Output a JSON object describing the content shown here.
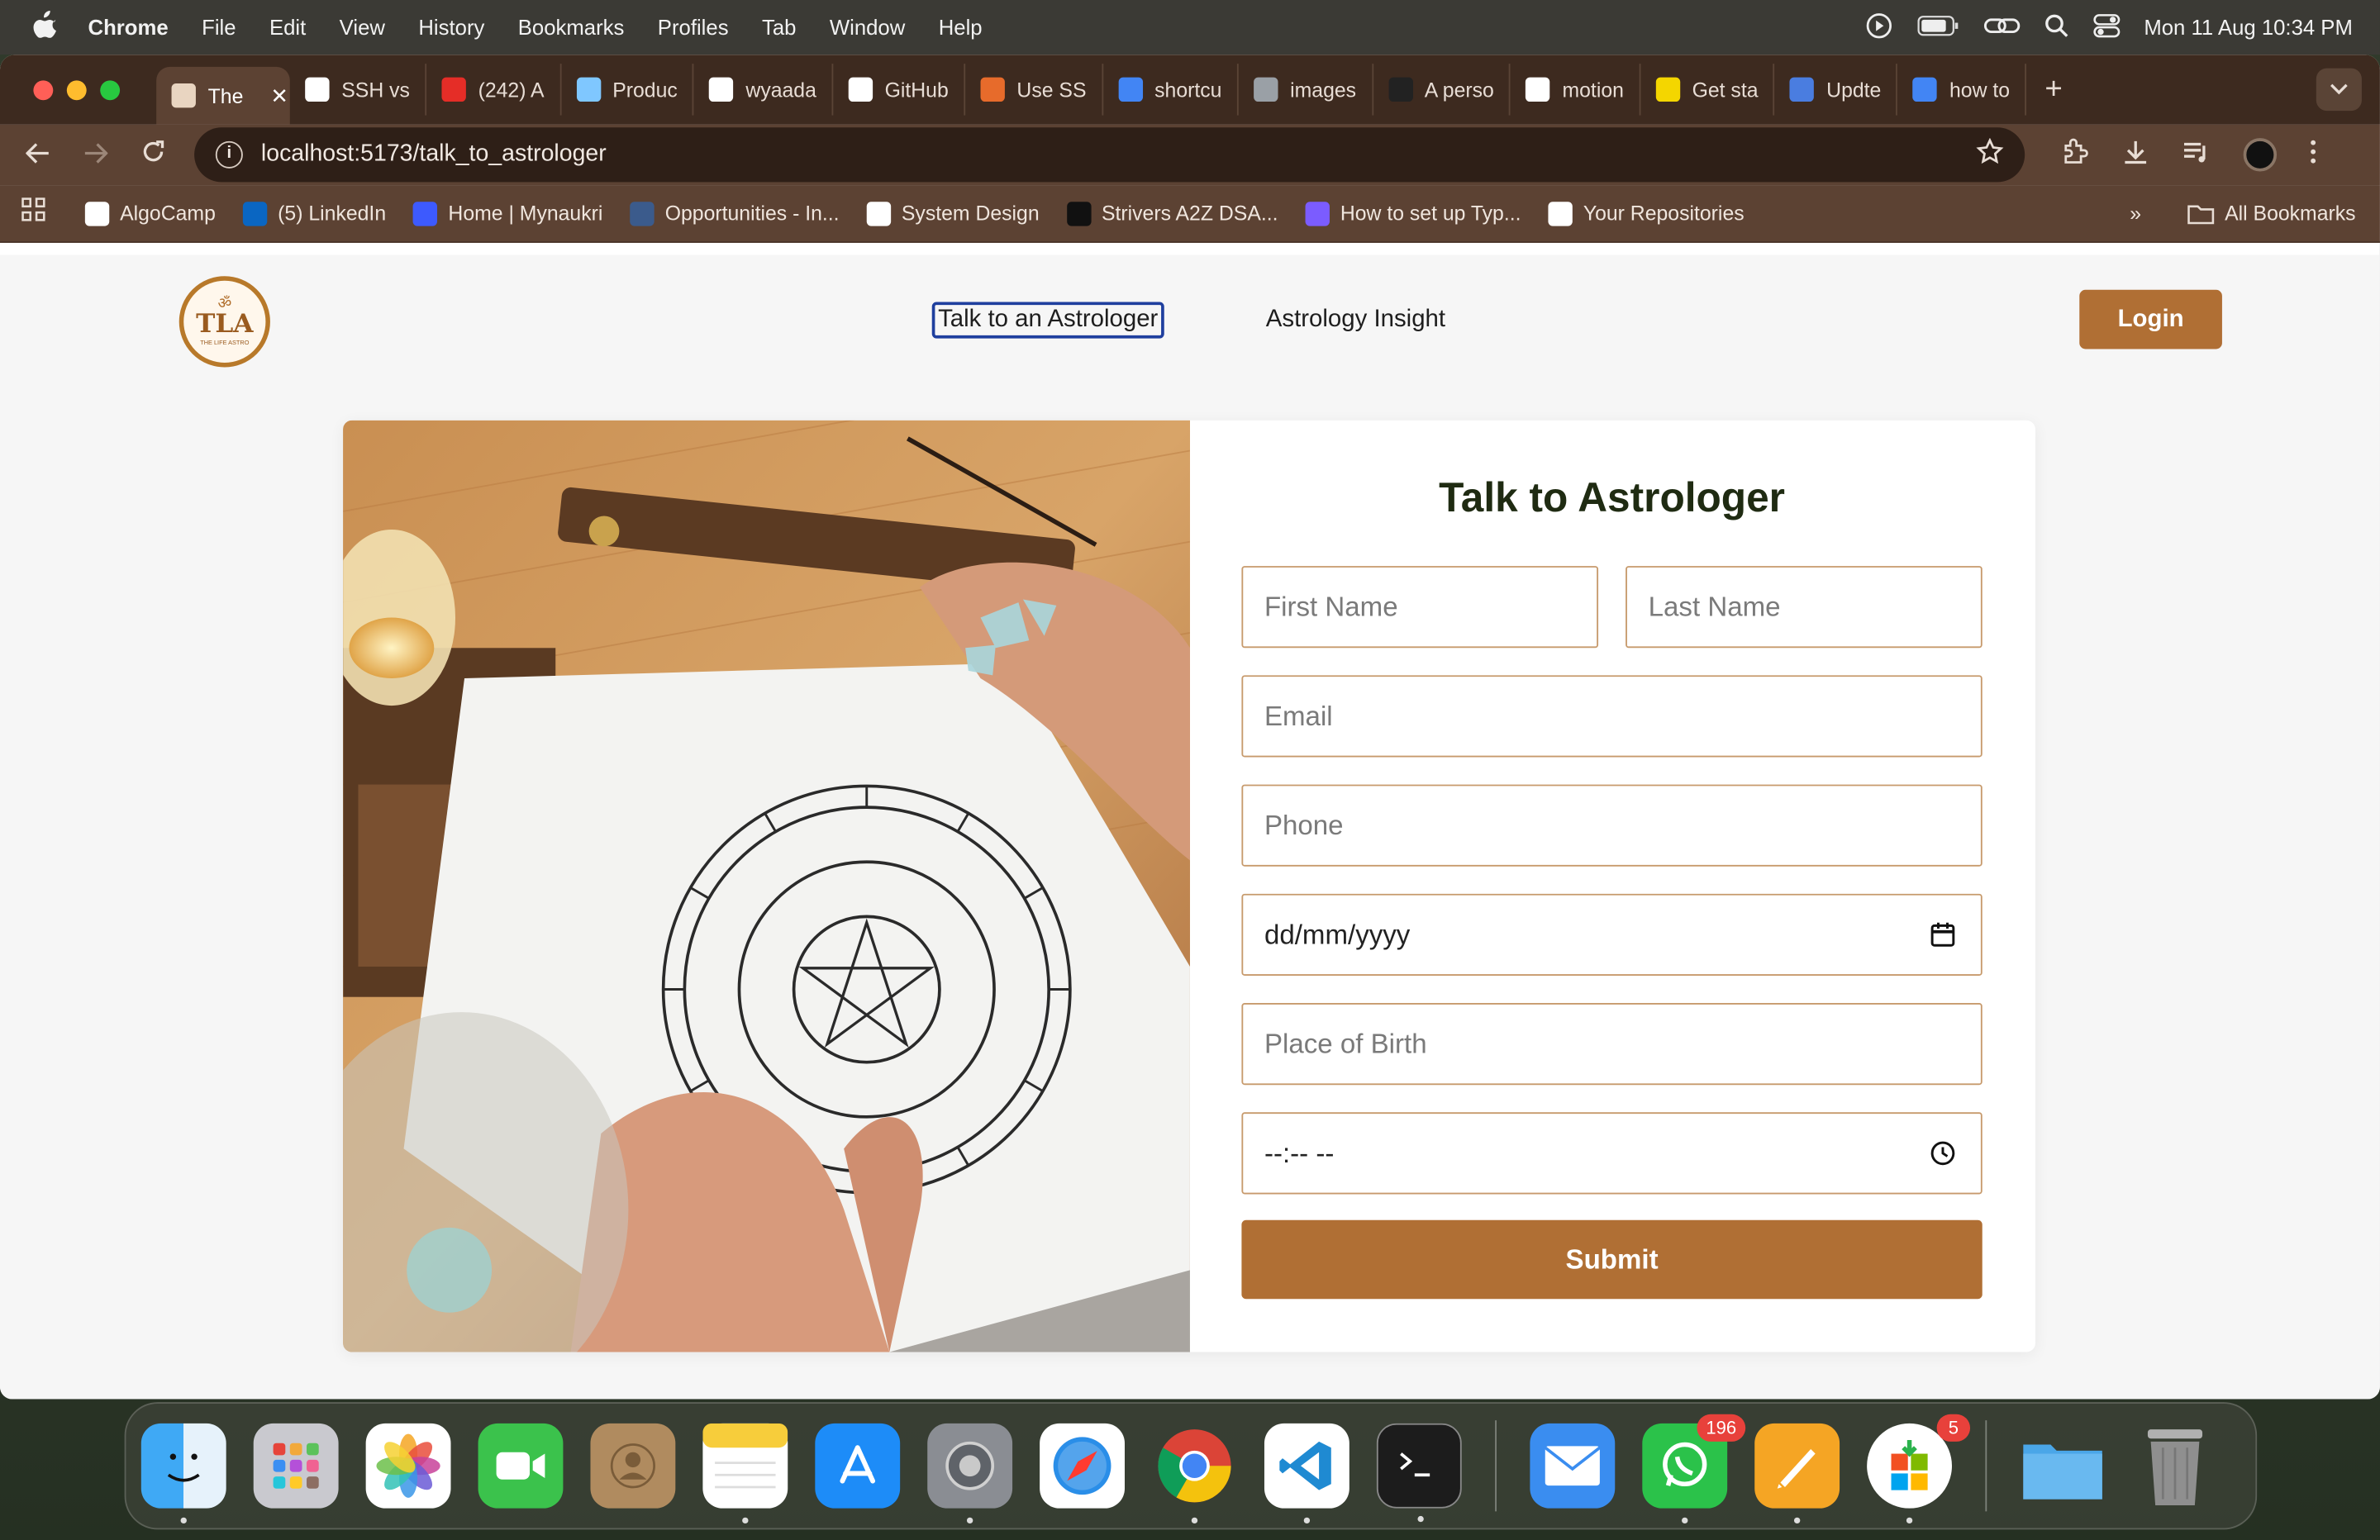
{
  "menubar": {
    "app": "Chrome",
    "items": [
      "File",
      "Edit",
      "View",
      "History",
      "Bookmarks",
      "Profiles",
      "Tab",
      "Window",
      "Help"
    ],
    "clock": "Mon 11 Aug  10:34 PM"
  },
  "tabs": [
    {
      "label": "The",
      "color": "#e9d5c1",
      "active": true
    },
    {
      "label": "SSH vs",
      "color": "#ffffff"
    },
    {
      "label": "(242) A",
      "color": "#e52d27"
    },
    {
      "label": "Produc",
      "color": "#7fc7ff"
    },
    {
      "label": "wyaada",
      "color": "#ffffff"
    },
    {
      "label": "GitHub",
      "color": "#ffffff"
    },
    {
      "label": "Use SS",
      "color": "#e76b2b"
    },
    {
      "label": "shortcu",
      "color": "#4285f4"
    },
    {
      "label": "images",
      "color": "#9aa0a6"
    },
    {
      "label": "A perso",
      "color": "#222222"
    },
    {
      "label": "motion",
      "color": "#ffffff"
    },
    {
      "label": "Get sta",
      "color": "#f4d600"
    },
    {
      "label": "Updte",
      "color": "#4a7de0"
    },
    {
      "label": "how to",
      "color": "#4285f4"
    }
  ],
  "address_bar": {
    "url": "localhost:5173/talk_to_astrologer"
  },
  "bookmarks": [
    {
      "label": "AlgoCamp",
      "color": "#ffffff"
    },
    {
      "label": "(5) LinkedIn",
      "color": "#0a66c2"
    },
    {
      "label": "Home | Mynaukri",
      "color": "#3d5afe"
    },
    {
      "label": "Opportunities - In...",
      "color": "#3b5b8c"
    },
    {
      "label": "System Design",
      "color": "#ffffff"
    },
    {
      "label": "Strivers A2Z DSA...",
      "color": "#111111"
    },
    {
      "label": "How to set up Typ...",
      "color": "#7b5cff"
    },
    {
      "label": "Your Repositories",
      "color": "#ffffff"
    }
  ],
  "bookmarks_all": "All Bookmarks",
  "site": {
    "logo_text": "TLA",
    "logo_om": "ॐ",
    "logo_sub": "THE LIFE ASTRO",
    "nav_talk": "Talk to an Astrologer",
    "nav_insight": "Astrology Insight",
    "login": "Login"
  },
  "form": {
    "title": "Talk to Astrologer",
    "first_name_placeholder": "First Name",
    "last_name_placeholder": "Last Name",
    "email_placeholder": "Email",
    "phone_placeholder": "Phone",
    "date_value": "dd/mm/yyyy",
    "place_placeholder": "Place of Birth",
    "time_value": "--:-- --",
    "submit": "Submit"
  },
  "dock": {
    "whatsapp_badge": "196",
    "store_badge": "5"
  }
}
